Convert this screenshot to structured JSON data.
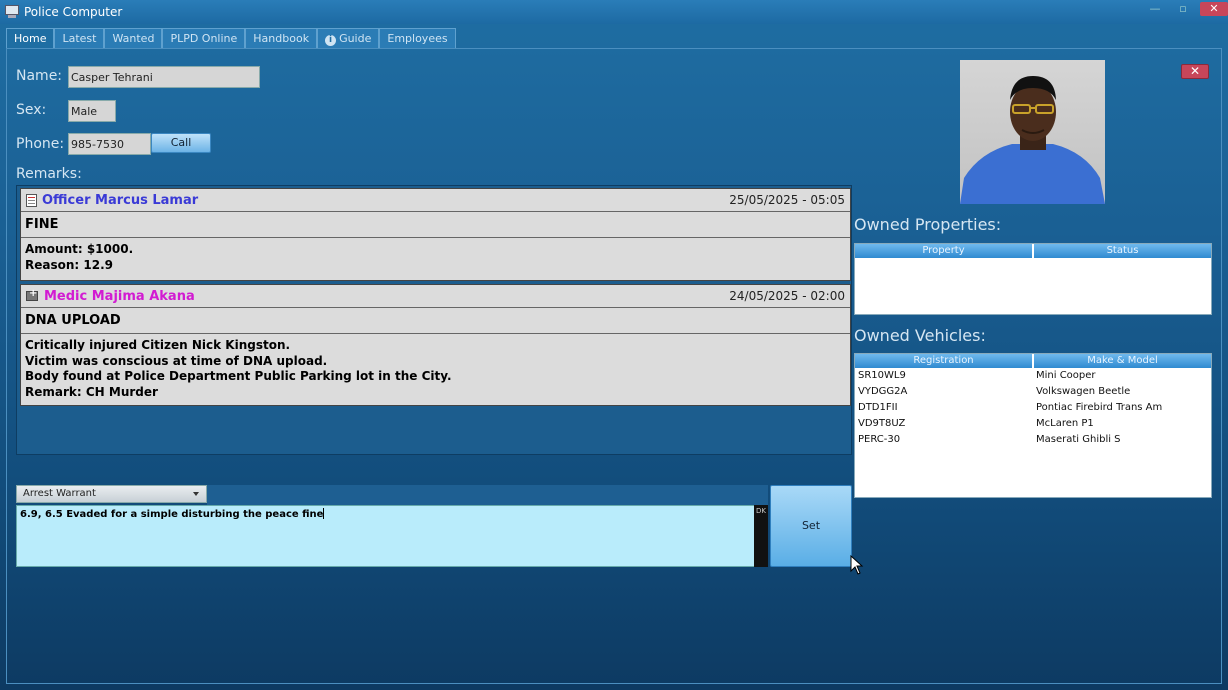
{
  "window": {
    "title": "Police Computer",
    "controls": {
      "minimize": "—",
      "maximize": "▫",
      "close": "✕"
    }
  },
  "tabs": [
    {
      "label": "Home",
      "active": true
    },
    {
      "label": "Latest"
    },
    {
      "label": "Wanted"
    },
    {
      "label": "PLPD Online"
    },
    {
      "label": "Handbook"
    },
    {
      "label": "Guide",
      "icon": "info-icon"
    },
    {
      "label": "Employees"
    }
  ],
  "profile": {
    "name_label": "Name:",
    "name": "Casper Tehrani",
    "sex_label": "Sex:",
    "sex": "Male",
    "phone_label": "Phone:",
    "phone": "985-7530",
    "call_button": "Call"
  },
  "remarks": {
    "label": "Remarks:",
    "entries": [
      {
        "author": "Officer Marcus Lamar",
        "author_color": "#3a3ad6",
        "icon": "document-icon",
        "date": "25/05/2025 - 05:05",
        "type": "FINE",
        "lines": [
          "Amount: $1000.",
          "Reason: 12.9"
        ]
      },
      {
        "author": "Medic Majima Akana",
        "author_color": "#d21bd2",
        "icon": "ambulance-icon",
        "date": "24/05/2025 - 02:00",
        "type": "DNA UPLOAD",
        "lines": [
          "Critically injured Citizen Nick Kingston.",
          "Victim was conscious at time of DNA upload.",
          "Body found at Police Department Public Parking lot in the City.",
          "Remark: CH Murder"
        ]
      }
    ]
  },
  "owned_properties": {
    "title": "Owned Properties:",
    "columns": [
      "Property",
      "Status"
    ],
    "rows": []
  },
  "owned_vehicles": {
    "title": "Owned Vehicles:",
    "columns": [
      "Registration",
      "Make & Model"
    ],
    "rows": [
      [
        "SR10WL9",
        "Mini Cooper"
      ],
      [
        "VYDGG2A",
        "Volkswagen Beetle"
      ],
      [
        "DTD1FII",
        "Pontiac Firebird Trans Am"
      ],
      [
        "VD9T8UZ",
        "McLaren P1"
      ],
      [
        "PERC-30",
        "Maserati Ghibli S"
      ]
    ]
  },
  "warrant": {
    "selected": "Arrest Warrant",
    "text": "6.9, 6.5 Evaded for a simple disturbing the peace fine",
    "scroll_tag": "DK",
    "set_button": "Set"
  },
  "colors": {
    "accent": "#1f6ea3",
    "close_red": "#c8465a",
    "textarea_bg": "#b9ecfb"
  }
}
